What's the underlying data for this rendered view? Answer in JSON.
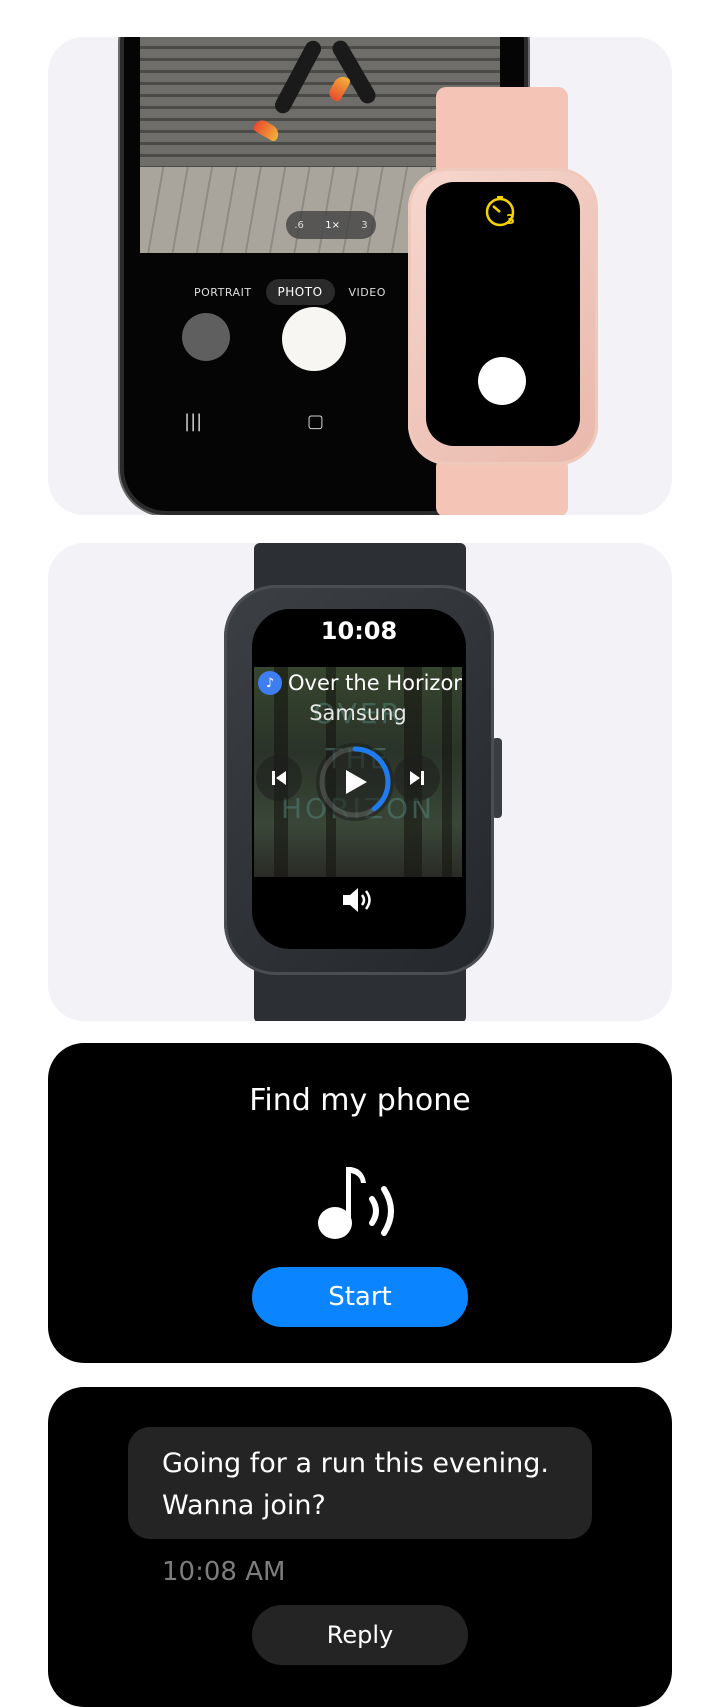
{
  "camera": {
    "zoom_options": [
      ".6",
      "1×",
      "3"
    ],
    "modes": [
      "PORTRAIT",
      "PHOTO",
      "VIDEO"
    ],
    "watch_timer_value": "3"
  },
  "music": {
    "time": "10:08",
    "song_title": "Over the Horizon",
    "artist": "Samsung",
    "progress": 0.4
  },
  "find_phone": {
    "title": "Find my phone",
    "start_label": "Start"
  },
  "message": {
    "text": "Going for a run this evening. Wanna join?",
    "time": "10:08 AM",
    "reply_label": "Reply"
  },
  "colors": {
    "card_light": "#f2f2f7",
    "accent_blue": "#0a84ff",
    "timer_yellow": "#f5d200",
    "watch_pink": "#f4c4b7",
    "watch_dark": "#2c2f33"
  }
}
